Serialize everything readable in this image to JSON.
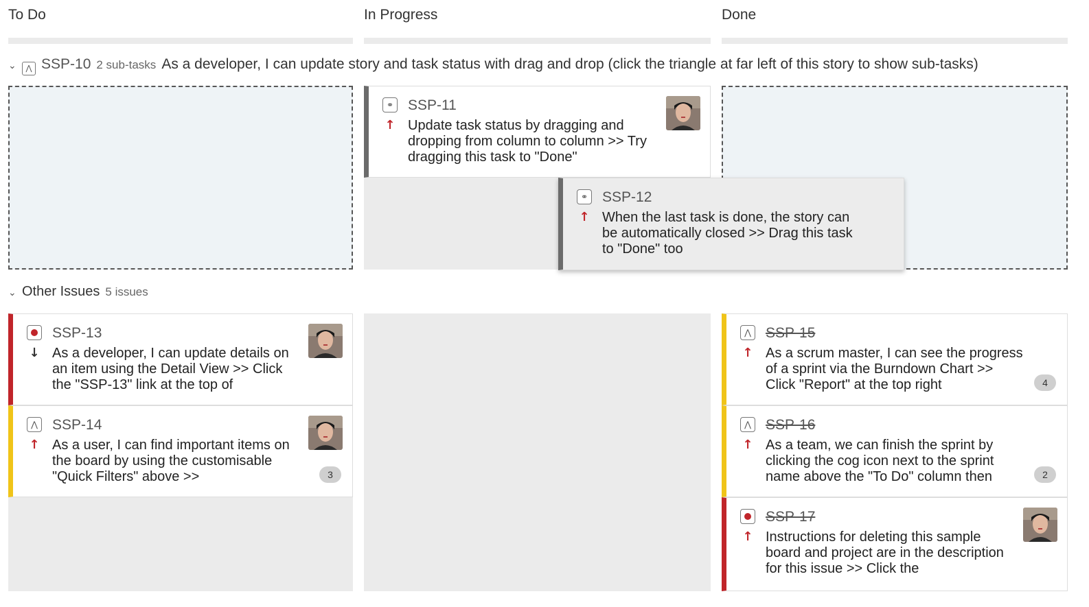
{
  "columns": [
    {
      "title": "To Do"
    },
    {
      "title": "In Progress"
    },
    {
      "title": "Done"
    }
  ],
  "swimlane_story": {
    "key": "SSP-10",
    "subtasks": "2 sub-tasks",
    "summary": "As a developer, I can update story and task status with drag and drop (click the triangle at far left of this story to show sub-tasks)"
  },
  "swimlane_other": {
    "title": "Other Issues",
    "count": "5 issues"
  },
  "cards": {
    "ssp11": {
      "key": "SSP-11",
      "summary": "Update task status by dragging and dropping from column to column >> Try dragging this task to \"Done\"",
      "type_icon": "subtask-icon",
      "priority": "high"
    },
    "ssp12": {
      "key": "SSP-12",
      "summary": "When the last task is done, the story can be automatically closed >> Drag this task to \"Done\" too",
      "type_icon": "subtask-icon",
      "priority": "high"
    },
    "ssp13": {
      "key": "SSP-13",
      "summary": "As a developer, I can update details on an item using the Detail View >> Click the \"SSP-13\" link at the top of",
      "type_icon": "bug-icon",
      "priority": "low"
    },
    "ssp14": {
      "key": "SSP-14",
      "summary": "As a user, I can find important items on the board by using the customisable \"Quick Filters\" above >>",
      "type_icon": "story-icon",
      "priority": "high",
      "badge": "3"
    },
    "ssp15": {
      "key": "SSP-15",
      "summary": "As a scrum master, I can see the progress of a sprint via the Burndown Chart >> Click \"Report\" at the top right",
      "type_icon": "story-icon",
      "priority": "high",
      "badge": "4"
    },
    "ssp16": {
      "key": "SSP-16",
      "summary": "As a team, we can finish the sprint by clicking the cog icon next to the sprint name above the \"To Do\" column then",
      "type_icon": "story-icon",
      "priority": "high",
      "badge": "2"
    },
    "ssp17": {
      "key": "SSP-17",
      "summary": "Instructions for deleting this sample board and project are in the description for this issue >> Click the",
      "type_icon": "bug-icon",
      "priority": "high"
    }
  },
  "colors": {
    "priority_high": "#c0252a",
    "bug_stripe": "#c0252a",
    "story_stripe": "#f0c419",
    "subtask_stripe": "#6b6b6b",
    "dropzone_bg": "#eef3f6",
    "column_bg": "#ebebeb"
  }
}
